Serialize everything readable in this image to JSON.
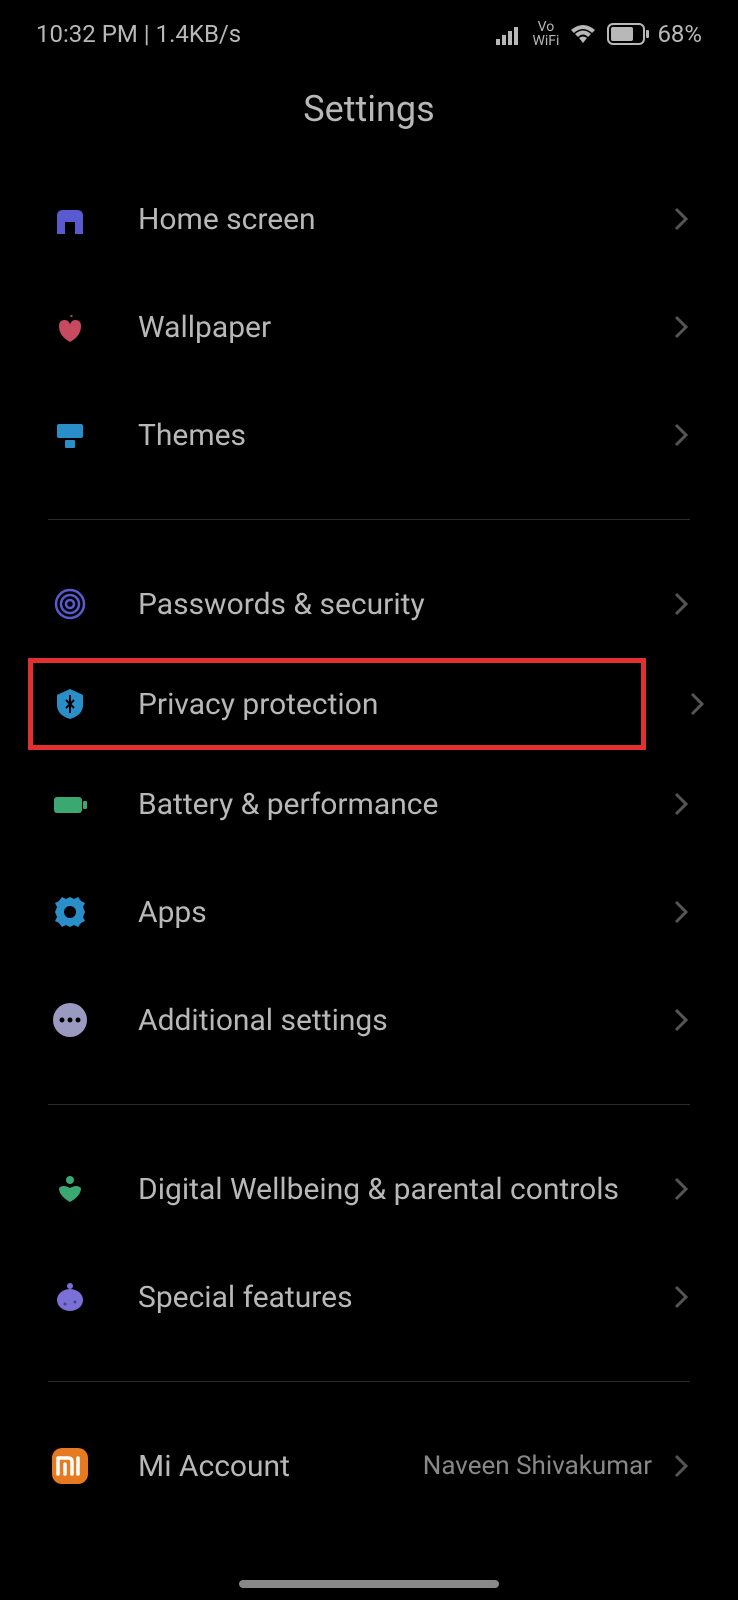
{
  "status_bar": {
    "time": "10:32 PM",
    "net_speed": "1.4KB/s",
    "vowifi_top": "Vo",
    "vowifi_bottom": "WiFi",
    "battery_percent": "68%"
  },
  "page": {
    "title": "Settings"
  },
  "items": {
    "home_screen": "Home screen",
    "wallpaper": "Wallpaper",
    "themes": "Themes",
    "passwords_security": "Passwords & security",
    "privacy_protection": "Privacy protection",
    "battery_performance": "Battery & performance",
    "apps": "Apps",
    "additional_settings": "Additional settings",
    "digital_wellbeing": "Digital Wellbeing & parental controls",
    "special_features": "Special features",
    "mi_account": "Mi Account",
    "mi_account_value": "Naveen Shivakumar"
  }
}
